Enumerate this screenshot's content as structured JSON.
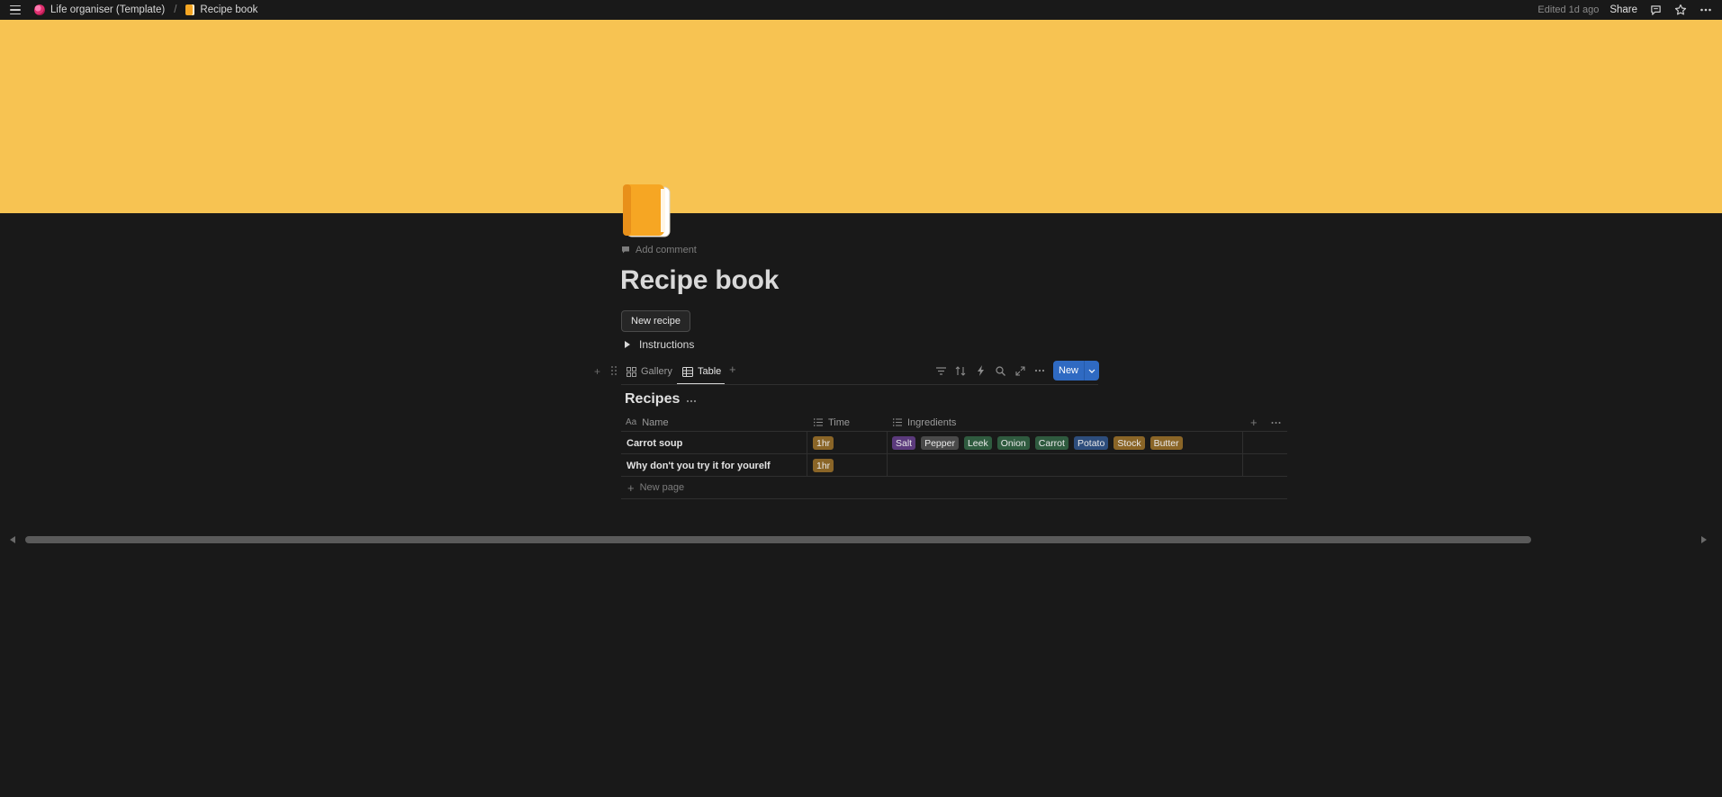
{
  "topbar": {
    "breadcrumbs": [
      {
        "label": "Life organiser (Template)",
        "icon": "life-organiser-icon"
      },
      {
        "label": "Recipe book",
        "icon": "book-icon"
      }
    ],
    "separator": "/",
    "edited": "Edited 1d ago",
    "share": "Share"
  },
  "cover": {
    "color": "#f7c352"
  },
  "page": {
    "add_comment": "Add comment",
    "title": "Recipe book",
    "new_recipe_button": "New recipe",
    "toggle_label": "Instructions"
  },
  "views": {
    "tabs": [
      {
        "label": "Gallery",
        "icon": "gallery-icon",
        "active": false
      },
      {
        "label": "Table",
        "icon": "table-icon",
        "active": true
      }
    ],
    "new_button": "New"
  },
  "database": {
    "title": "Recipes",
    "columns": [
      {
        "label": "Name",
        "icon": "Aa"
      },
      {
        "label": "Time",
        "icon": "list-icon"
      },
      {
        "label": "Ingredients",
        "icon": "list-icon"
      }
    ],
    "rows": [
      {
        "name": "Carrot soup",
        "time": "1hr",
        "ingredients": [
          {
            "label": "Salt",
            "color": "#5b3a7c"
          },
          {
            "label": "Pepper",
            "color": "#4a4a4a"
          },
          {
            "label": "Leek",
            "color": "#2f5b3f"
          },
          {
            "label": "Onion",
            "color": "#2f5b3f"
          },
          {
            "label": "Carrot",
            "color": "#2f5b3f"
          },
          {
            "label": "Potato",
            "color": "#2d4d7c"
          },
          {
            "label": "Stock",
            "color": "#8a6527"
          },
          {
            "label": "Butter",
            "color": "#8a6527"
          }
        ]
      },
      {
        "name": "Why don't you try it for yourelf",
        "time": "1hr",
        "ingredients": []
      }
    ],
    "new_page": "New page",
    "time_tag_color": "#8a6527"
  }
}
